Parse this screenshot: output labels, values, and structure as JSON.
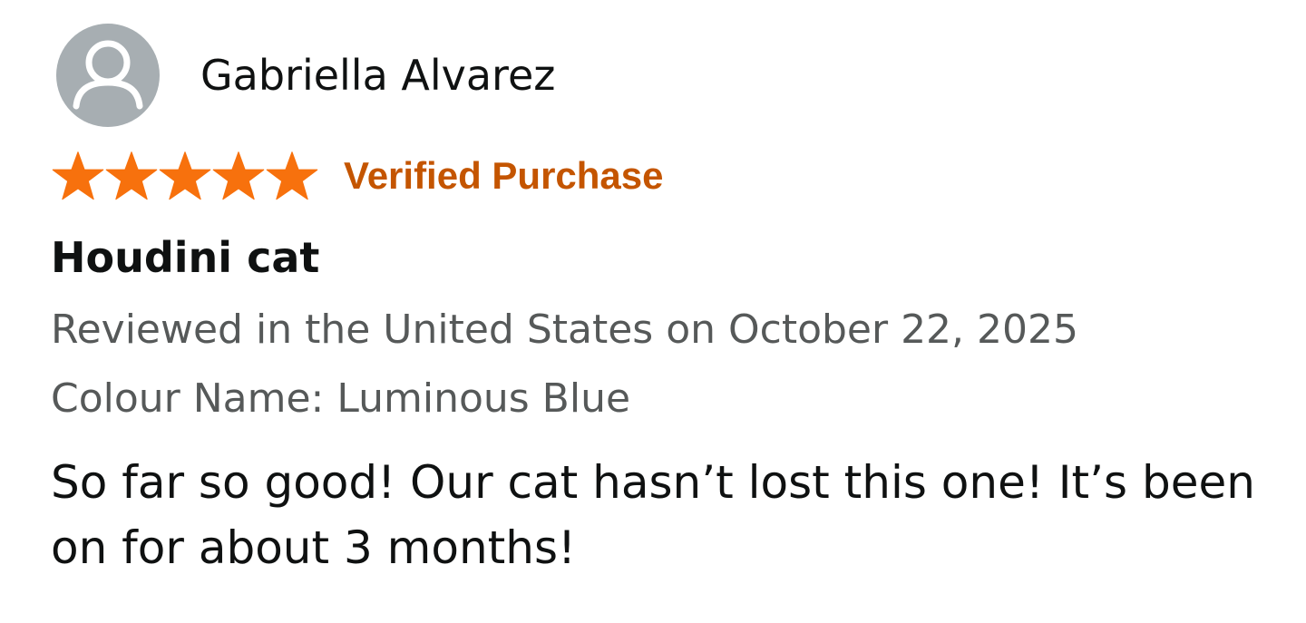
{
  "reviewer": {
    "name": "Gabriella Alvarez",
    "avatar_icon": "default-profile-icon",
    "avatar_bg": "#a7aeb2"
  },
  "rating": {
    "stars": 5,
    "max": 5,
    "star_icon": "star-icon",
    "star_color": "#f7710d"
  },
  "badge": {
    "label": "Verified Purchase",
    "color": "#c45500"
  },
  "review": {
    "title": "Houdini cat",
    "date_line": "Reviewed in the United States on October 22, 2025",
    "variant_line": "Colour Name: Luminous Blue",
    "body": "So far so good! Our cat hasn’t lost this one! It’s been on for about 3 months!"
  }
}
